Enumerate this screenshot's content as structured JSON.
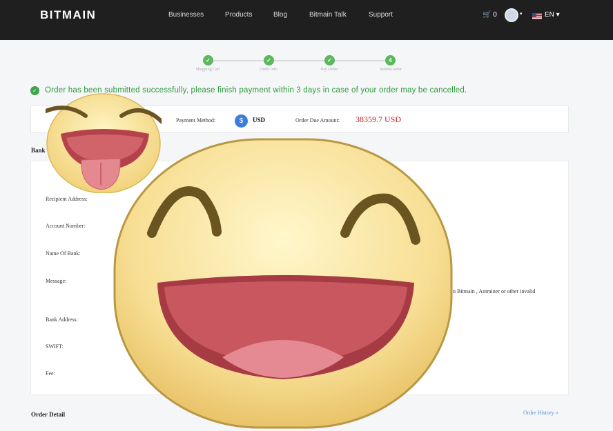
{
  "header": {
    "logo": "BITMAIN",
    "nav": [
      "Businesses",
      "Products",
      "Blog",
      "Bitmain Talk",
      "Support"
    ],
    "cart_count": "0",
    "lang": "EN"
  },
  "stepper": {
    "steps": [
      {
        "mark": "✓",
        "label": "Shopping Cart"
      },
      {
        "mark": "✓",
        "label": "Order info"
      },
      {
        "mark": "✓",
        "label": "Pay Order"
      },
      {
        "mark": "4",
        "label": "Submit order"
      }
    ]
  },
  "success_message": "Order has been submitted successfully, please finish payment within 3 days in case of your order may be cancelled.",
  "payment": {
    "method_label": "Payment Method:",
    "currency_symbol": "$",
    "currency": "USD",
    "amount_label": "Order Due Amount:",
    "amount": "38359.7 USD"
  },
  "bank": {
    "heading": "Bank",
    "fields": [
      "Recipient Address:",
      "Account Number:",
      "Name Of Bank:",
      "Message:",
      "Bank Address:",
      "SWIFT:",
      "Fee:"
    ],
    "note": "n Bitmain , Antminer or other invalid"
  },
  "order_detail": {
    "heading": "Order Detail",
    "history_link": "Order History"
  },
  "colors": {
    "success": "#2f9a3f",
    "amount": "#c5252c",
    "link": "#5b8fd6",
    "topbar": "#1f1f1f"
  },
  "overlays": [
    "tongue-out-emoji",
    "laughing-emoji"
  ]
}
